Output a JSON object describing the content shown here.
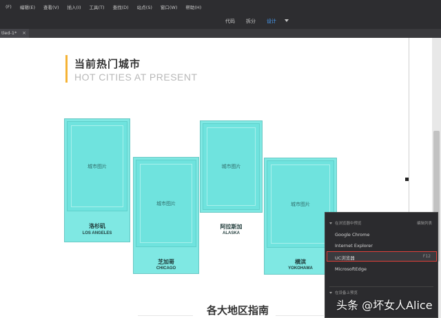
{
  "menu": {
    "items": [
      "(F)",
      "编辑(E)",
      "查看(V)",
      "插入(I)",
      "工具(T)",
      "查找(D)",
      "站点(S)",
      "窗口(W)",
      "帮助(H)"
    ]
  },
  "view_toolbar": {
    "code_label": "代码",
    "split_label": "拆分",
    "design_label": "设计"
  },
  "document_tab": {
    "label": "tled-1*",
    "close_glyph": "×"
  },
  "page": {
    "title_cn": "当前热门城市",
    "title_en": "HOT CITIES AT PRESENT",
    "cities": [
      {
        "placeholder": "城市图片",
        "name_cn": "洛杉矶",
        "name_en": "LOS ANGELES"
      },
      {
        "placeholder": "城市图片",
        "name_cn": "芝加哥",
        "name_en": "CHICAGO"
      },
      {
        "placeholder": "城市图片",
        "name_cn": "阿拉斯加",
        "name_en": "ALASKA"
      },
      {
        "placeholder": "城市图片",
        "name_cn": "横滨",
        "name_en": "YOKOHAMA"
      }
    ],
    "section2_title": "各大地区指南"
  },
  "context_menu": {
    "header1": "在浏览器中预览",
    "header1_shortcut": "编辑列表",
    "items": [
      "Google Chrome",
      "Internet Explorer",
      "UC浏览器",
      "MicrosoftEdge"
    ],
    "highlighted_key": "F12",
    "header2": "在设备上预览"
  },
  "watermark": "头条 @坏女人Alice",
  "colors": {
    "card_fill": "#7fe8e3",
    "accent": "#f5b335",
    "active_tab": "#4aa3ff",
    "menu_highlight_border": "#e0403a"
  }
}
